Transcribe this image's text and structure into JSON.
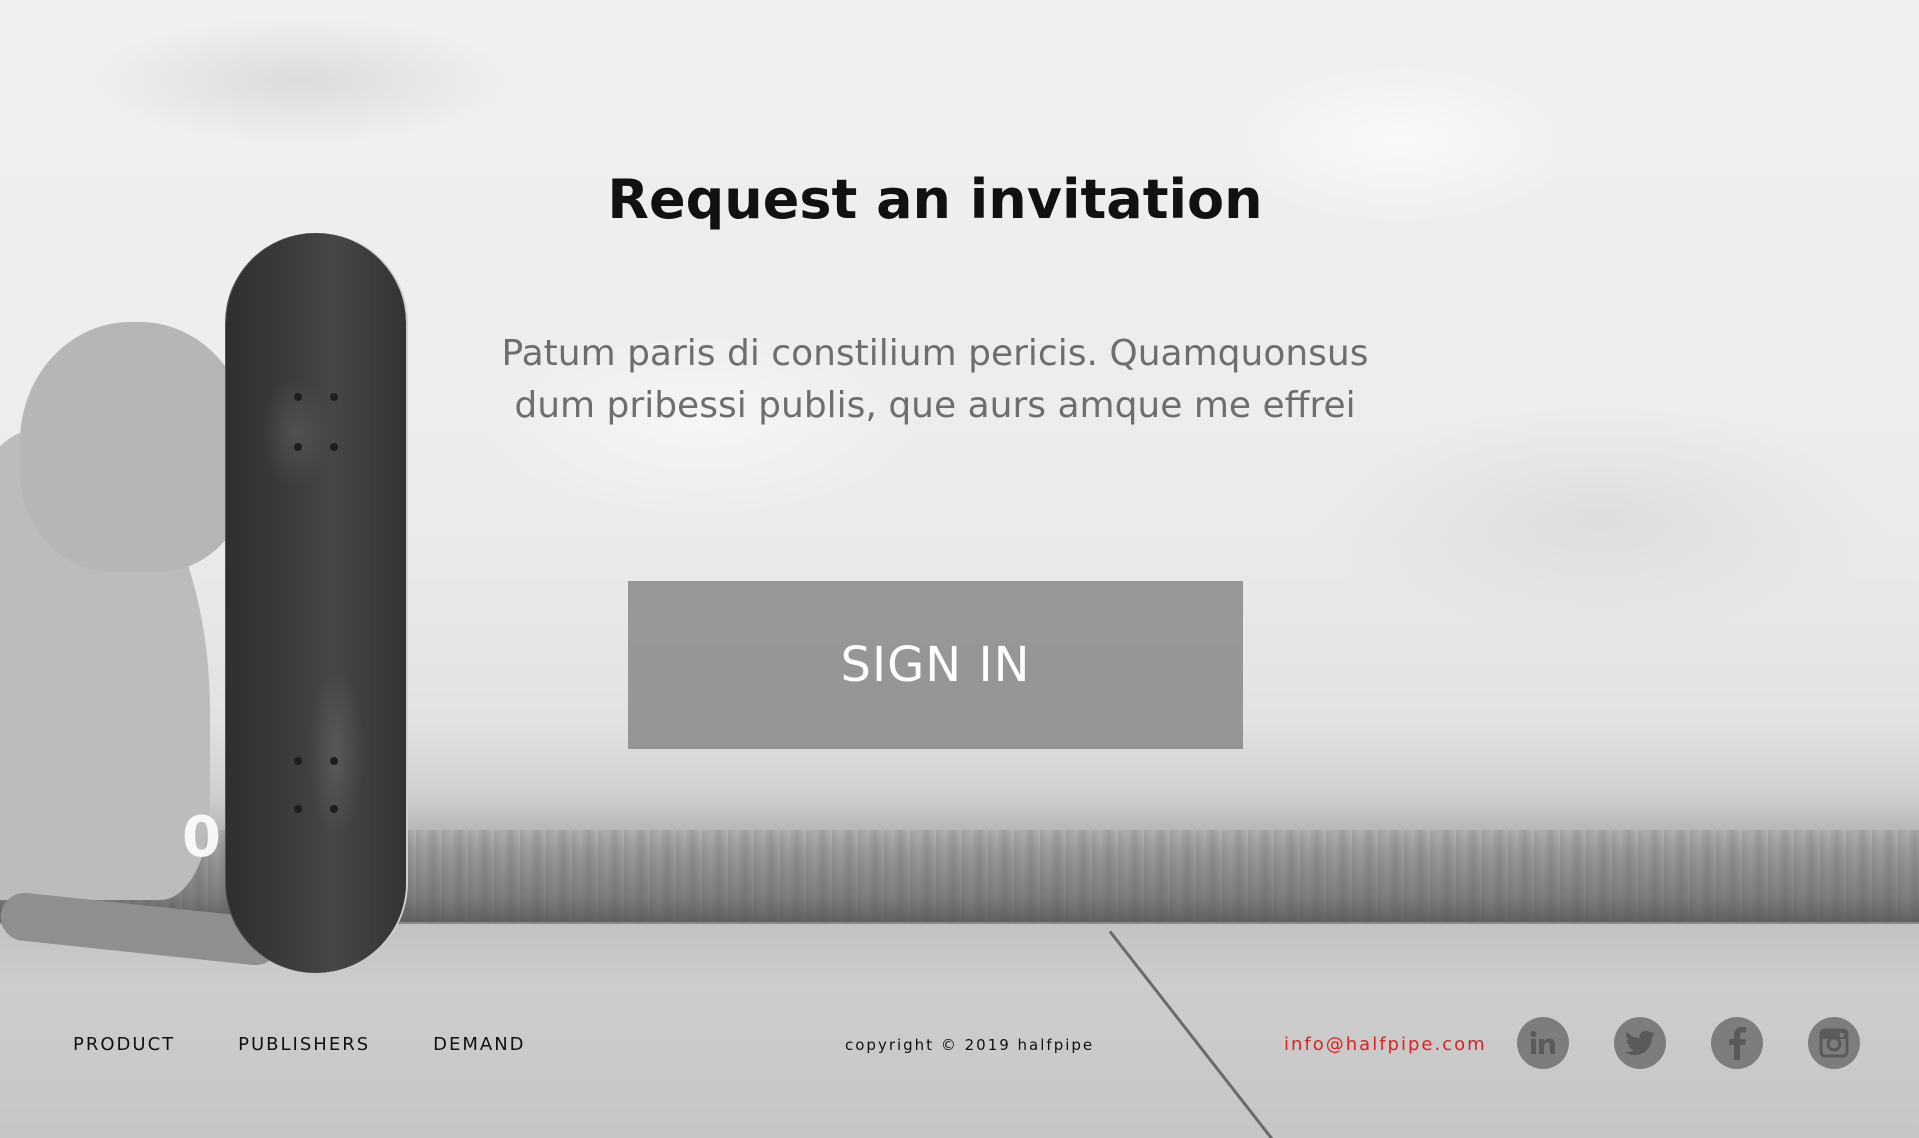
{
  "hero": {
    "title": "Request an invitation",
    "subtitle": "Patum paris di constilium pericis. Quamquonsus dum pribessi publis, que aurs amque me effrei",
    "sign_in_label": "SIGN IN",
    "wall_number": "05"
  },
  "footer": {
    "nav": [
      "PRODUCT",
      "PUBLISHERS",
      "DEMAND"
    ],
    "copyright": "copyright © 2019 halfpipe",
    "email": "info@halfpipe.com",
    "social_icons": [
      "linkedin-icon",
      "twitter-icon",
      "facebook-icon",
      "instagram-icon"
    ]
  },
  "colors": {
    "email": "#e02020",
    "title": "#111111",
    "subtitle": "#6e6e6e",
    "button_bg": "#808080",
    "social_bg": "#7d7d7d"
  }
}
